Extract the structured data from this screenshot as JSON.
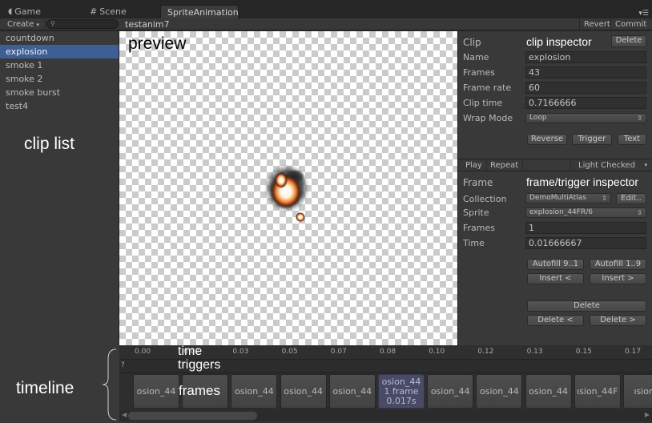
{
  "tabs": [
    {
      "label": "Game",
      "icon": "pacman-icon"
    },
    {
      "label": "Scene",
      "icon": "grid-icon"
    },
    {
      "label": "SpriteAnimation",
      "icon": ""
    }
  ],
  "toolbar": {
    "create_label": "Create",
    "search_placeholder": "",
    "clip_name": "testanim7",
    "revert_label": "Revert",
    "commit_label": "Commit"
  },
  "clip_list": {
    "items": [
      "countdown",
      "explosion",
      "smoke 1",
      "smoke 2",
      "smoke burst",
      "test4"
    ],
    "selected": "explosion"
  },
  "annotations": {
    "preview": "preview",
    "clip_list": "clip list",
    "timeline": "timeline",
    "time": "time",
    "triggers": "triggers",
    "frames": "frames",
    "clip_inspector": "clip inspector",
    "frame_trigger_inspector": "frame/trigger inspector"
  },
  "clip_inspector": {
    "header": "Clip",
    "delete_label": "Delete",
    "name_label": "Name",
    "name_value": "explosion",
    "frames_label": "Frames",
    "frames_value": "43",
    "framerate_label": "Frame rate",
    "framerate_value": "60",
    "cliptime_label": "Clip time",
    "cliptime_value": "0.7166666",
    "wrapmode_label": "Wrap Mode",
    "wrapmode_value": "Loop",
    "reverse_label": "Reverse",
    "trigger_label": "Trigger",
    "text_label": "Text"
  },
  "playbar": {
    "play_label": "Play",
    "repeat_label": "Repeat",
    "background_value": "Light Checked"
  },
  "frame_inspector": {
    "header": "Frame",
    "collection_label": "Collection",
    "collection_value": "DemoMultiAtlas",
    "edit_label": "Edit..",
    "sprite_label": "Sprite",
    "sprite_value": "explosion_44FR/6",
    "frames_label": "Frames",
    "frames_value": "1",
    "time_label": "Time",
    "time_value": "0.01666667",
    "autofill_desc_label": "Autofill 9..1",
    "autofill_asc_label": "Autofill 1..9",
    "insert_before_label": "Insert <",
    "insert_after_label": "Insert >",
    "delete_label": "Delete",
    "delete_before_label": "Delete <",
    "delete_after_label": "Delete >"
  },
  "timeline": {
    "ticks": [
      "0.00",
      "0.02",
      "0.03",
      "0.05",
      "0.07",
      "0.08",
      "0.10",
      "0.12",
      "0.13",
      "0.15",
      "0.17"
    ],
    "trigger_marker": "?",
    "frames": [
      {
        "label": "osion_44"
      },
      {
        "label": ""
      },
      {
        "label": "osion_44"
      },
      {
        "label": "osion_44"
      },
      {
        "label": "osion_44"
      },
      {
        "label": "osion_44",
        "line2": "1 frame",
        "line3": "0.017s",
        "selected": true
      },
      {
        "label": "osion_44"
      },
      {
        "label": "osion_44"
      },
      {
        "label": "osion_44"
      },
      {
        "label": "ısion_44F"
      },
      {
        "label": "ısion_"
      }
    ]
  }
}
